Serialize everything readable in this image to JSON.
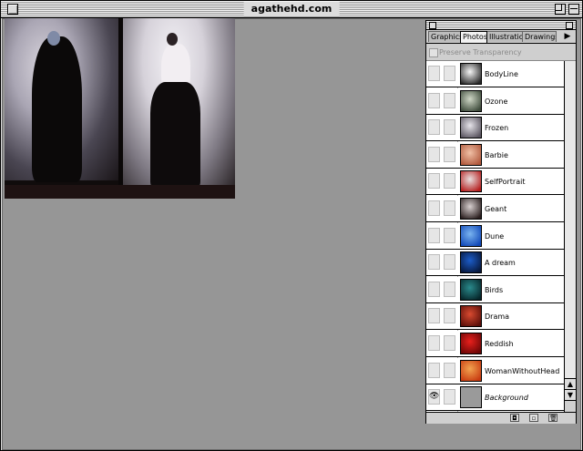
{
  "window": {
    "title": "agathehd.com"
  },
  "layers_panel": {
    "tabs": [
      {
        "label": "Graphics",
        "active": false
      },
      {
        "label": "Photos",
        "active": true
      },
      {
        "label": "Illustrations",
        "active": false
      },
      {
        "label": "Drawings",
        "active": false
      }
    ],
    "preserve_transparency_label": "Preserve Transparency",
    "layers": [
      {
        "name": "BodyLine",
        "visible": false,
        "italic": false,
        "thumb_colors": [
          "#f6f6f6",
          "#2a2a2a"
        ]
      },
      {
        "name": "Ozone",
        "visible": false,
        "italic": false,
        "thumb_colors": [
          "#cfd7c6",
          "#3d4a3a"
        ]
      },
      {
        "name": "Frozen",
        "visible": false,
        "italic": false,
        "thumb_colors": [
          "#e6e4ea",
          "#5a5560"
        ]
      },
      {
        "name": "Barbie",
        "visible": false,
        "italic": false,
        "thumb_colors": [
          "#f0c0a6",
          "#b0583c"
        ]
      },
      {
        "name": "SelfPortrait",
        "visible": false,
        "italic": false,
        "thumb_colors": [
          "#e8e0e0",
          "#b41c1c"
        ]
      },
      {
        "name": "Geant",
        "visible": false,
        "italic": false,
        "thumb_colors": [
          "#d8d0d0",
          "#2a1e1e"
        ]
      },
      {
        "name": "Dune",
        "visible": false,
        "italic": false,
        "thumb_colors": [
          "#7ab4f0",
          "#1048b8"
        ]
      },
      {
        "name": "A dream",
        "visible": false,
        "italic": false,
        "thumb_colors": [
          "#1c5cc8",
          "#07183c"
        ]
      },
      {
        "name": "Birds",
        "visible": false,
        "italic": false,
        "thumb_colors": [
          "#2a8a8c",
          "#06262a"
        ]
      },
      {
        "name": "Drama",
        "visible": false,
        "italic": false,
        "thumb_colors": [
          "#d84a30",
          "#5a0e08"
        ]
      },
      {
        "name": "Reddish",
        "visible": false,
        "italic": false,
        "thumb_colors": [
          "#e8201c",
          "#6a0606"
        ]
      },
      {
        "name": "WomanWithoutHead",
        "visible": false,
        "italic": false,
        "thumb_colors": [
          "#f2a450",
          "#c83a10"
        ]
      },
      {
        "name": "Background",
        "visible": true,
        "italic": true,
        "thumb_colors": [
          "#9a9a9a",
          "#9a9a9a"
        ]
      }
    ],
    "footer_icons": [
      "layer-mask-icon",
      "new-layer-icon",
      "trash-icon"
    ]
  },
  "glyphs": {
    "eye": "👁",
    "menu_arrow": "▶",
    "scroll_up": "▲",
    "scroll_down": "▼",
    "mask": "◘",
    "new_layer": "▫",
    "trash": "🗑"
  }
}
